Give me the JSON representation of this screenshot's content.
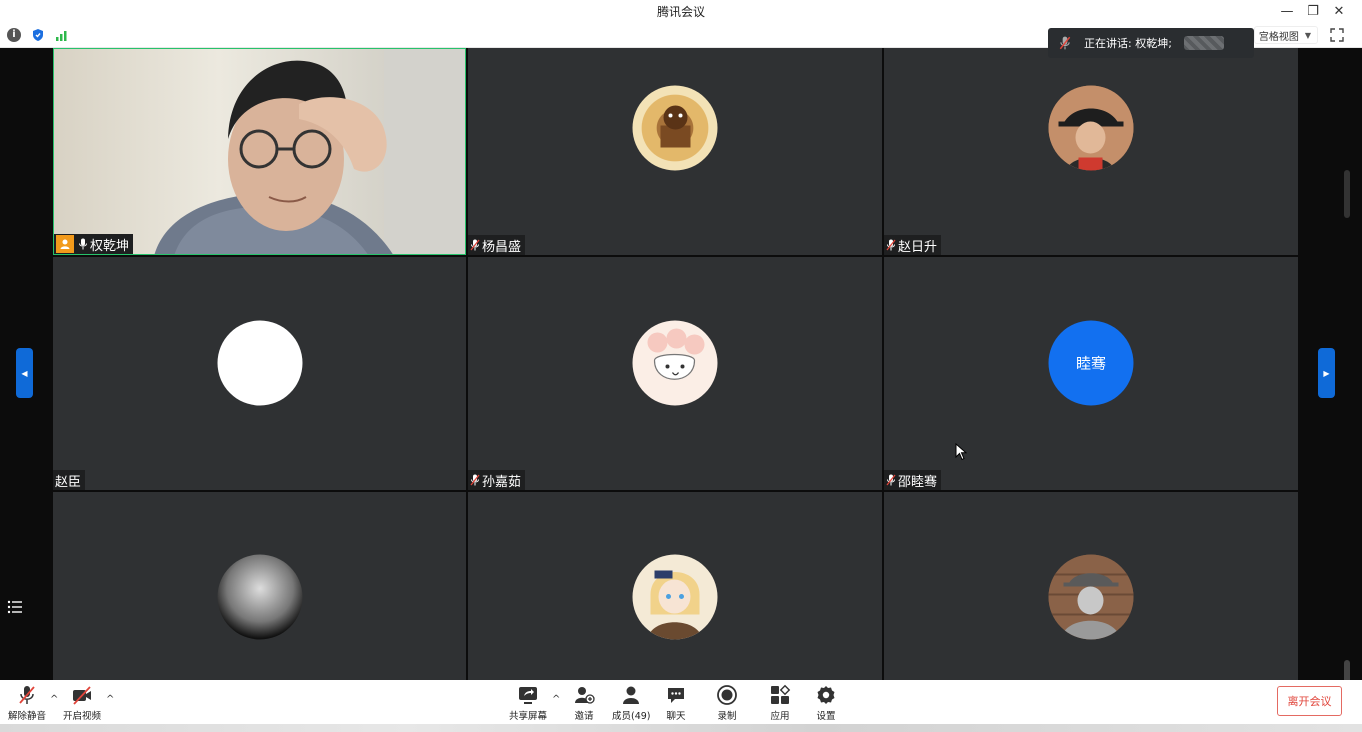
{
  "window": {
    "title": "腾讯会议",
    "minimize": "—",
    "restore": "❐",
    "close": "✕"
  },
  "infobar": {
    "view_mode": "宫格视图"
  },
  "speaking": {
    "text": "正在讲话: 权乾坤;"
  },
  "participants": [
    {
      "name": "权乾坤",
      "host": true,
      "video": true
    },
    {
      "name": "杨昌盛"
    },
    {
      "name": "赵日升"
    },
    {
      "name": "赵臣",
      "no_mic": true
    },
    {
      "name": "孙嘉茹"
    },
    {
      "name": "邵睦骞",
      "avatar_text": "睦骞"
    },
    {
      "name": ""
    },
    {
      "name": ""
    },
    {
      "name": ""
    }
  ],
  "toolbar": {
    "unmute": "解除静音",
    "start_video": "开启视频",
    "share": "共享屏幕",
    "invite": "邀请",
    "members": "成员(49)",
    "chat": "聊天",
    "record": "录制",
    "apps": "应用",
    "settings": "设置",
    "leave": "离开会议"
  },
  "colors": {
    "accent": "#0f6ad8",
    "leave": "#e0443a",
    "host": "#f29a1b",
    "tile": "#2f3133"
  }
}
